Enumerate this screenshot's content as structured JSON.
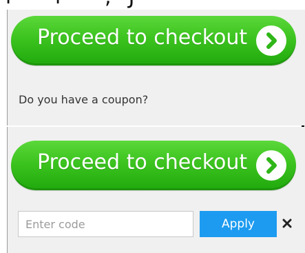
{
  "checkout": {
    "button_label": "Proceed to checkout",
    "icon": "chevron-right-circle-icon",
    "color": "#3cc31f"
  },
  "coupon": {
    "prompt": "Do you have a coupon?",
    "input_value": "",
    "input_placeholder": "Enter code",
    "apply_label": "Apply",
    "apply_color": "#1d9bf0",
    "close_icon": "close-icon"
  }
}
